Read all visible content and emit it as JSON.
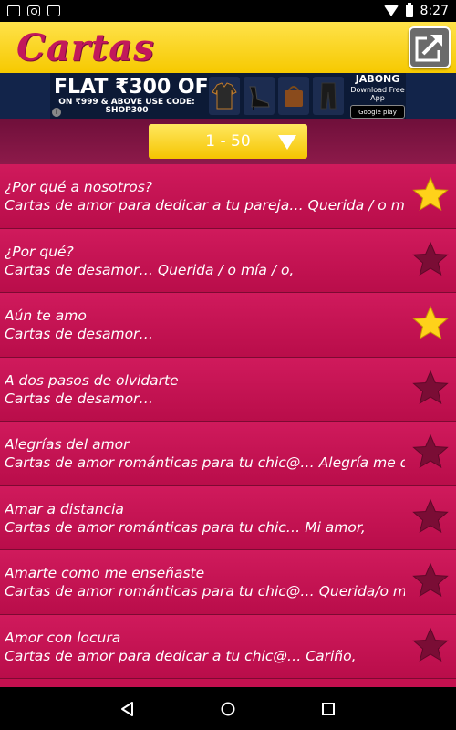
{
  "status_bar": {
    "time": "8:27"
  },
  "app_bar": {
    "title": "Cartas"
  },
  "ad": {
    "headline": "FLAT ₹300 OFF",
    "subline": "ON ₹999 & ABOVE USE CODE: SHOP300",
    "brand": "JABONG",
    "brand_sub": "Download Free App",
    "store_badge": "Google play"
  },
  "range_selector": {
    "label": "1 - 50"
  },
  "colors": {
    "accent_yellow": "#f6c900",
    "list_pink": "#c4104f",
    "star_gold": "#ffd21a",
    "star_dim": "#7a0d35"
  },
  "items": [
    {
      "title": "¿Por qué a nosotros?",
      "desc": "Cartas de amor para dedicar a tu pareja… Querida / o mía / o,",
      "favorite": true
    },
    {
      "title": "¿Por qué?",
      "desc": "Cartas de desamor… Querida / o mía / o,",
      "favorite": false
    },
    {
      "title": "Aún te amo",
      "desc": "Cartas de desamor…",
      "favorite": true
    },
    {
      "title": "A dos pasos de olvidarte",
      "desc": "Cartas de desamor…",
      "favorite": false
    },
    {
      "title": "Alegrías del amor",
      "desc": "Cartas de amor románticas para tu chic@… Alegría me da",
      "favorite": false
    },
    {
      "title": "Amar a distancia",
      "desc": "Cartas de amor románticas para tu chic… Mi amor,",
      "favorite": false
    },
    {
      "title": "Amarte como me enseñaste",
      "desc": "Cartas de amor románticas para tu chic@… Querida/o mía",
      "favorite": false
    },
    {
      "title": "Amor con locura",
      "desc": "Cartas de amor para dedicar a tu chic@… Cariño,",
      "favorite": false
    }
  ]
}
